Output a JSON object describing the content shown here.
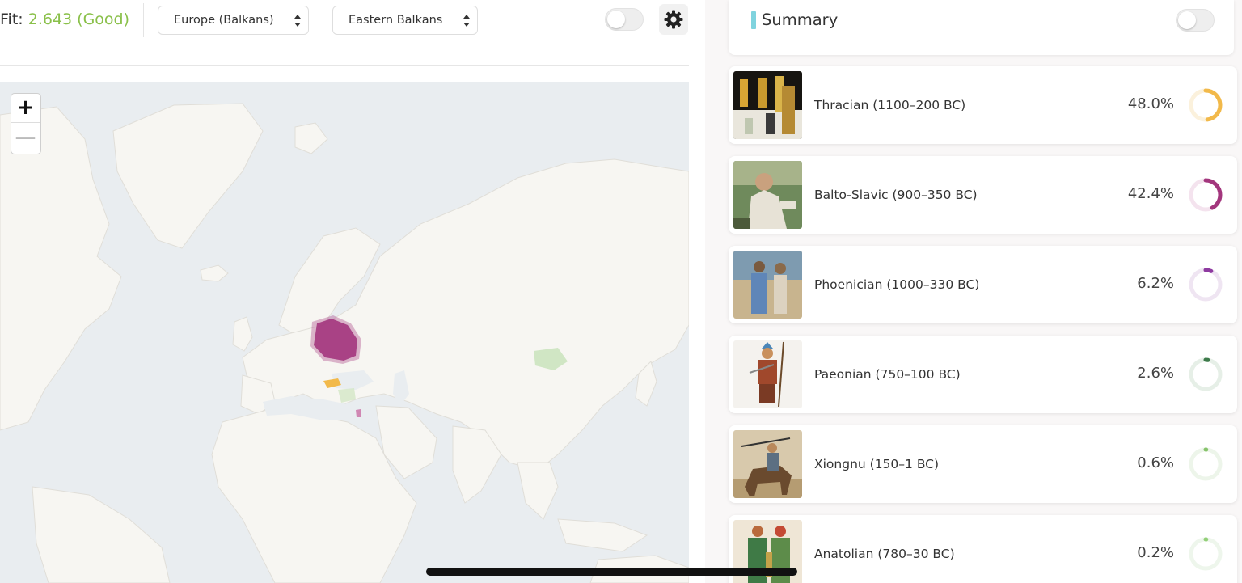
{
  "toolbar": {
    "fit_label": "Fit:",
    "fit_value": "2.643 (Good)",
    "region_select": "Europe (Balkans)",
    "subregion_select": "Eastern Balkans"
  },
  "map": {
    "zoom_in": "+",
    "zoom_out": "—"
  },
  "summary": {
    "title": "Summary"
  },
  "populations": [
    {
      "name": "Thracian (1100–200 BC)",
      "percent": "48.0%",
      "fraction": 0.48,
      "color": "#f2b94a",
      "track": "#fbf1dc"
    },
    {
      "name": "Balto-Slavic (900–350 BC)",
      "percent": "42.4%",
      "fraction": 0.424,
      "color": "#a3367d",
      "track": "#f4e3ee"
    },
    {
      "name": "Phoenician (1000–330 BC)",
      "percent": "6.2%",
      "fraction": 0.062,
      "color": "#8e3aa0",
      "track": "#efe5f2"
    },
    {
      "name": "Paeonian (750–100 BC)",
      "percent": "2.6%",
      "fraction": 0.026,
      "color": "#3d7a4a",
      "track": "#e6efe7"
    },
    {
      "name": "Xiongnu (150–1 BC)",
      "percent": "0.6%",
      "fraction": 0.006,
      "color": "#86c36b",
      "track": "#edf5ea"
    },
    {
      "name": "Anatolian (780–30 BC)",
      "percent": "0.2%",
      "fraction": 0.002,
      "color": "#92cf78",
      "track": "#eef6ec"
    }
  ],
  "colors": {
    "fit_good": "#8ac04a",
    "summary_accent": "#7fd3de",
    "map_water": "#e9edf0",
    "map_land": "#f7f6f2"
  },
  "icons": {
    "settings": "gear-icon",
    "select": "sort-arrows-icon"
  }
}
